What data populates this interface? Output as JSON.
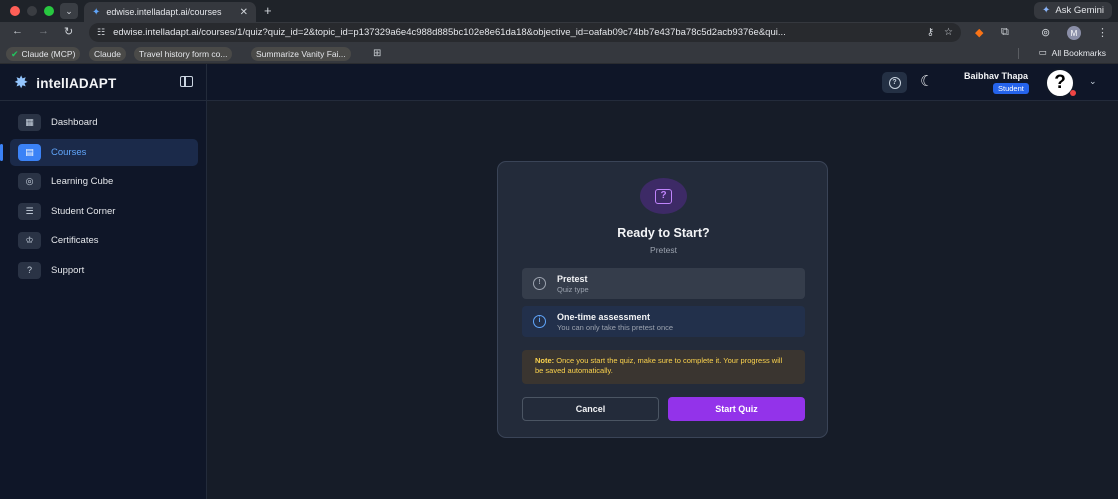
{
  "browser": {
    "tab_title": "edwise.intelladapt.ai/courses",
    "new_tab": "+",
    "gemini_label": "Ask Gemini",
    "url": "edwise.intelladapt.ai/courses/1/quiz?quiz_id=2&topic_id=p137329a6e4c988d885bc102e8e61da18&objective_id=oafab09c74bb7e437ba78c5d2acb9376e&qui...",
    "profile_initial": "M",
    "bookmarks": [
      "Claude (MCP)",
      "Claude",
      "Travel history form co...",
      "Summarize Vanity Fai..."
    ],
    "all_bookmarks": "All Bookmarks"
  },
  "app": {
    "brand_name": "intellADAPT",
    "nav": [
      {
        "label": "Dashboard",
        "icon": "dashboard-icon",
        "active": false
      },
      {
        "label": "Courses",
        "icon": "courses-icon",
        "active": true
      },
      {
        "label": "Learning Cube",
        "icon": "learning-cube-icon",
        "active": false
      },
      {
        "label": "Student Corner",
        "icon": "student-corner-icon",
        "active": false
      },
      {
        "label": "Certificates",
        "icon": "certificate-icon",
        "active": false
      },
      {
        "label": "Support",
        "icon": "support-icon",
        "active": false
      }
    ],
    "user": {
      "name": "Baibhav Thapa",
      "role": "Student",
      "avatar_glyph": "?"
    }
  },
  "modal": {
    "title": "Ready to Start?",
    "subtitle": "Pretest",
    "rows": [
      {
        "title": "Pretest",
        "desc": "Quiz type"
      },
      {
        "title": "One-time assessment",
        "desc": "You can only take this pretest once"
      }
    ],
    "note_label": "Note:",
    "note_text": "Once you start the quiz, make sure to complete it. Your progress will be saved automatically.",
    "cancel_label": "Cancel",
    "start_label": "Start Quiz"
  },
  "colors": {
    "accent": "#3b82f6",
    "primary_button": "#9333ea",
    "note_text": "#fcd34d",
    "sidebar_bg": "#0f1628"
  }
}
